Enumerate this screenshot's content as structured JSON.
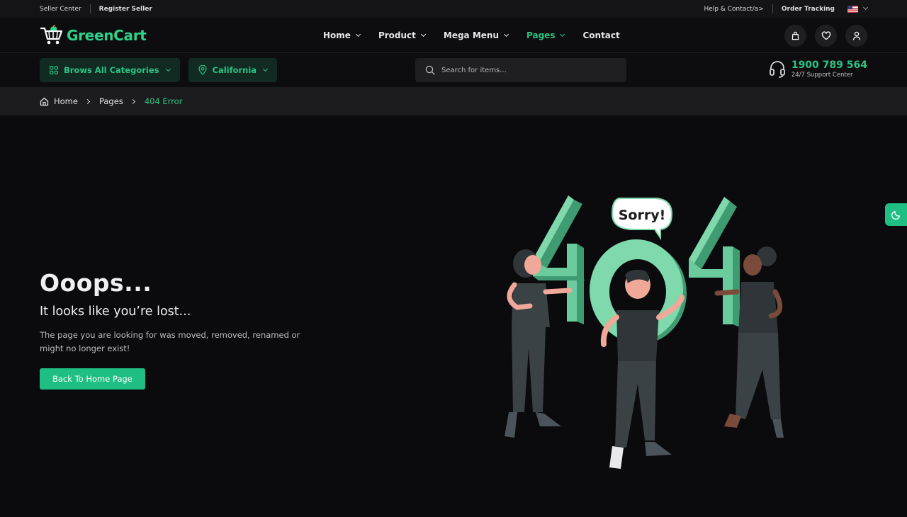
{
  "topbar": {
    "seller_center": "Seller Center",
    "register_seller": "Register Seller",
    "help_contact": "Help & Contact/a>",
    "order_tracking": "Order Tracking"
  },
  "brand": {
    "name": "GreenCart",
    "accent_color": "#2bc482"
  },
  "nav": {
    "items": [
      {
        "label": "Home",
        "has_dropdown": true,
        "active": false
      },
      {
        "label": "Product",
        "has_dropdown": true,
        "active": false
      },
      {
        "label": "Mega Menu",
        "has_dropdown": true,
        "active": false
      },
      {
        "label": "Pages",
        "has_dropdown": true,
        "active": true
      },
      {
        "label": "Contact",
        "has_dropdown": false,
        "active": false
      }
    ],
    "actions": [
      "shopping-bag-icon",
      "heart-icon",
      "user-icon"
    ]
  },
  "subheader": {
    "categories_label": "Brows All Categories",
    "location_label": "California",
    "search_placeholder": "Search for items...",
    "support_number": "1900 789 564",
    "support_label": "24/7 Support Center"
  },
  "breadcrumb": {
    "items": [
      "Home",
      "Pages",
      "404 Error"
    ]
  },
  "hero": {
    "title": "Ooops...",
    "subtitle": "It looks like you’re lost...",
    "description": "The page you are looking for was moved, removed, renamed or might no longer exist!",
    "button_label": "Back To Home Page"
  },
  "illustration": {
    "bubble_text": "Sorry!",
    "digits": "404"
  }
}
